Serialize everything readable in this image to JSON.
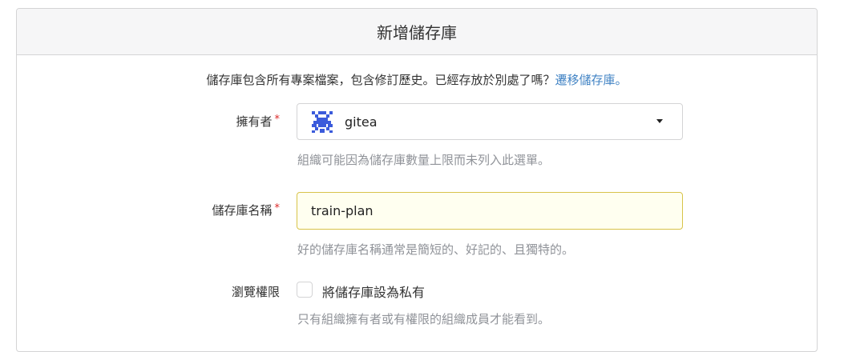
{
  "header": {
    "title": "新增儲存庫"
  },
  "intro": {
    "text": "儲存庫包含所有專案檔案，包含修訂歷史。已經存放於別處了嗎？",
    "migrate_link": "遷移儲存庫。"
  },
  "owner": {
    "label": "擁有者",
    "required_mark": "*",
    "selected": "gitea",
    "avatar_icon": "gitea-org-avatar-icon",
    "help": "組織可能因為儲存庫數量上限而未列入此選單。"
  },
  "repo_name": {
    "label": "儲存庫名稱",
    "required_mark": "*",
    "value": "train-plan",
    "help": "好的儲存庫名稱通常是簡短的、好記的、且獨特的。"
  },
  "visibility": {
    "label": "瀏覽權限",
    "checkbox_label": "將儲存庫設為私有",
    "checked": false,
    "help": "只有組織擁有者或有權限的組織成員才能看到。"
  },
  "colors": {
    "link": "#4183c4",
    "required": "#db2828",
    "focus_border": "#d8c34a",
    "focus_bg": "#fffff0",
    "avatar": "#3b5bdb"
  }
}
